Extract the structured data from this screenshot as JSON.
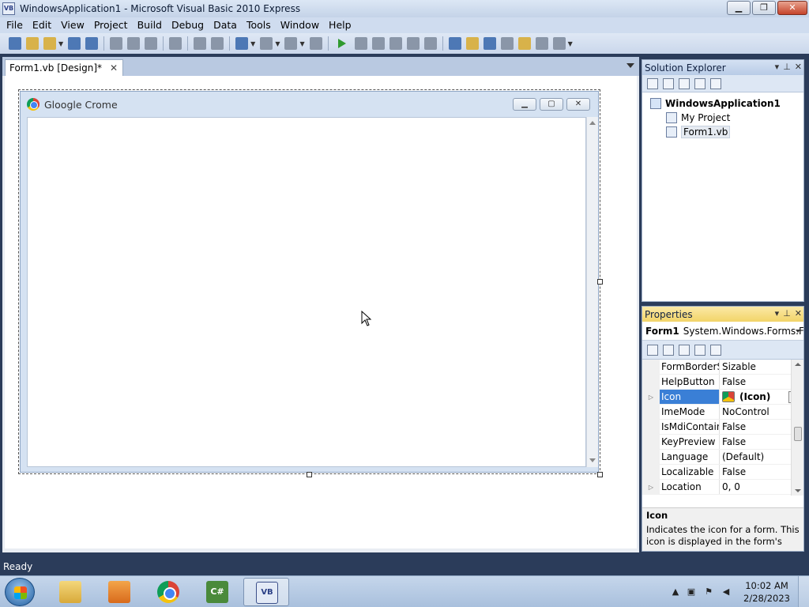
{
  "window": {
    "title": "WindowsApplication1 - Microsoft Visual Basic 2010 Express"
  },
  "menu": [
    "File",
    "Edit",
    "View",
    "Project",
    "Build",
    "Debug",
    "Data",
    "Tools",
    "Window",
    "Help"
  ],
  "document_tab": {
    "label": "Form1.vb [Design]*",
    "close": "✕"
  },
  "designed_form": {
    "title": "Gloogle Crome"
  },
  "solution_explorer": {
    "title": "Solution Explorer",
    "root": "WindowsApplication1",
    "items": [
      "My Project",
      "Form1.vb"
    ]
  },
  "properties": {
    "title": "Properties",
    "object_name": "Form1",
    "object_type": "System.Windows.Forms.Fo",
    "rows": [
      {
        "name": "FormBorderSt",
        "value": "Sizable"
      },
      {
        "name": "HelpButton",
        "value": "False"
      },
      {
        "name": "Icon",
        "value": "(Icon)"
      },
      {
        "name": "ImeMode",
        "value": "NoControl"
      },
      {
        "name": "IsMdiContain",
        "value": "False"
      },
      {
        "name": "KeyPreview",
        "value": "False"
      },
      {
        "name": "Language",
        "value": "(Default)"
      },
      {
        "name": "Localizable",
        "value": "False"
      },
      {
        "name": "Location",
        "value": "0, 0"
      }
    ],
    "description_title": "Icon",
    "description_text": "Indicates the icon for a form. This icon is displayed in the form's syst..."
  },
  "status": {
    "text": "Ready"
  },
  "clock": {
    "time": "10:02 AM",
    "date": "2/28/2023"
  },
  "colors": {
    "accent": "#3a7fd6",
    "statusbar": "#2b3c5a",
    "active_panel": "#f2d468"
  }
}
